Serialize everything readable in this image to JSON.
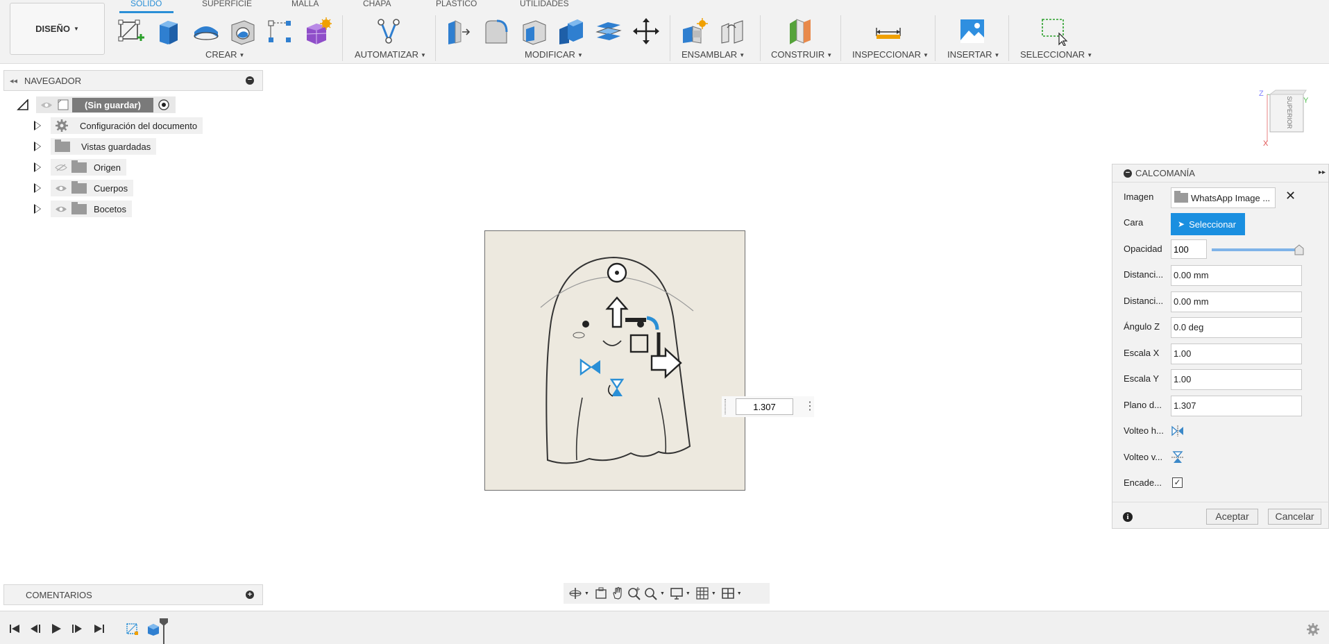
{
  "toolbar": {
    "workspace_button": "DISEÑO",
    "tabs": [
      {
        "label": "SÓLIDO",
        "active": true
      },
      {
        "label": "SUPERFICIE",
        "active": false
      },
      {
        "label": "MALLA",
        "active": false
      },
      {
        "label": "CHAPA",
        "active": false
      },
      {
        "label": "PLÁSTICO",
        "active": false
      },
      {
        "label": "UTILIDADES",
        "active": false
      }
    ],
    "groups": [
      {
        "label": "CREAR"
      },
      {
        "label": "AUTOMATIZAR"
      },
      {
        "label": "MODIFICAR"
      },
      {
        "label": "ENSAMBLAR"
      },
      {
        "label": "CONSTRUIR"
      },
      {
        "label": "INSPECCIONAR"
      },
      {
        "label": "INSERTAR"
      },
      {
        "label": "SELECCIONAR"
      }
    ],
    "accent_color": "#2a8fd6"
  },
  "navigator": {
    "title": "NAVEGADOR",
    "root": {
      "label": "(Sin guardar)"
    },
    "items": [
      {
        "label": "Configuración del documento",
        "icon": "gear-icon"
      },
      {
        "label": "Vistas guardadas",
        "icon": "folder-icon"
      },
      {
        "label": "Origen",
        "icon": "folder-icon",
        "visible": false
      },
      {
        "label": "Cuerpos",
        "icon": "folder-icon",
        "visible": true
      },
      {
        "label": "Bocetos",
        "icon": "folder-icon",
        "visible": true
      }
    ]
  },
  "canvas": {
    "value_input": "1.307",
    "viewcube_face": "SUPERIOR",
    "axes": {
      "z": "Z",
      "y": "Y",
      "x": "X"
    }
  },
  "decal_panel": {
    "title": "CALCOMANÍA",
    "image_label": "Imagen",
    "image_value": "WhatsApp Image ...",
    "face_label": "Cara",
    "face_button": "Seleccionar",
    "opacity_label": "Opacidad",
    "opacity_value": "100",
    "opacity_fraction": 1.0,
    "dist1_label": "Distanci...",
    "dist1_value": "0.00 mm",
    "dist2_label": "Distanci...",
    "dist2_value": "0.00 mm",
    "anglez_label": "Ángulo Z",
    "anglez_value": "0.0 deg",
    "scalex_label": "Escala X",
    "scalex_value": "1.00",
    "scaley_label": "Escala Y",
    "scaley_value": "1.00",
    "plane_label": "Plano d...",
    "plane_value": "1.307",
    "fliph_label": "Volteo h...",
    "flipv_label": "Volteo v...",
    "chain_label": "Encade...",
    "chain_checked": true,
    "ok_button": "Aceptar",
    "cancel_button": "Cancelar"
  },
  "comments": {
    "title": "COMENTARIOS"
  }
}
